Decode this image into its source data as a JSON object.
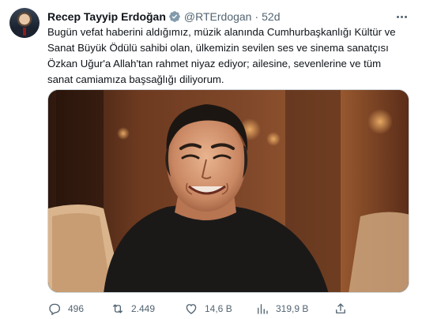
{
  "author": {
    "name": "Recep Tayyip Erdoğan",
    "handle": "@RTErdogan",
    "separator": "·",
    "time": "52d"
  },
  "tweet": {
    "lines": [
      "Bugün vefat haberini aldığımız, müzik alanında Cumhurbaşkanlığı Kültür ve",
      "Sanat Büyük Ödülü sahibi olan, ülkemizin sevilen ses ve sinema sanatçısı",
      "Özkan Uğur'a Allah'tan rahmet niyaz ediyor; ailesine, sevenlerine ve tüm",
      "sanat camiamıza başsağlığı diliyorum."
    ]
  },
  "actions": {
    "replies": "496",
    "reposts": "2.449",
    "likes": "14,6 B",
    "views": "319,9 B"
  },
  "colors": {
    "text": "#0f1419",
    "secondary": "#536471",
    "verified_badge": "#829aab"
  },
  "icons": [
    "more-icon",
    "verified-badge-icon",
    "reply-icon",
    "repost-icon",
    "like-icon",
    "views-icon",
    "share-icon"
  ]
}
